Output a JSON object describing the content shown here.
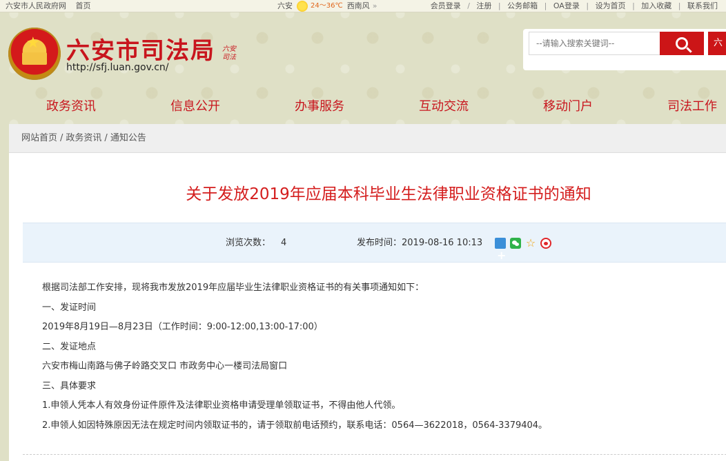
{
  "topbar": {
    "gov_link": "六安市人民政府网",
    "home_link": "首页",
    "city": "六安",
    "temperature": "24～36℃",
    "wind": "西南风",
    "more_arrow": "»",
    "links": [
      "会员登录",
      "注册",
      "公务邮箱",
      "OA登录",
      "设为首页",
      "加入收藏",
      "联系我们"
    ],
    "sep_slash": "/",
    "sep_bar": "|"
  },
  "header": {
    "site_title": "六安市司法局",
    "site_url": "http://sfj.luan.gov.cn/",
    "seal_text": "六安司法",
    "emblem_star": "★"
  },
  "search": {
    "placeholder": "--请输入搜索关键词--",
    "lang_button": "六"
  },
  "nav": {
    "items": [
      "政务资讯",
      "信息公开",
      "办事服务",
      "互动交流",
      "移动门户",
      "司法工作"
    ]
  },
  "breadcrumb": {
    "items": [
      "网站首页",
      "政务资讯",
      "通知公告"
    ],
    "separator": "/"
  },
  "article": {
    "title": "关于发放2019年应届本科毕业生法律职业资格证书的通知",
    "views_label": "浏览次数：",
    "views_value": "4",
    "date_label": "发布时间：2019-08-16 10:13",
    "fav_symbol": "☆",
    "paragraphs": [
      "根据司法部工作安排，现将我市发放2019年应届毕业生法律职业资格证书的有关事项通知如下：",
      "一、发证时间",
      "2019年8月19日—8月23日（工作时间：9:00-12:00,13:00-17:00）",
      "二、发证地点",
      "六安市梅山南路与佛子岭路交叉口 市政务中心一楼司法局窗口",
      "三、具体要求",
      "1.申领人凭本人有效身份证件原件及法律职业资格申请受理单领取证书，不得由他人代领。",
      "2.申领人如因特殊原因无法在规定时间内领取证书的，请于领取前电话预约，联系电话：0564—3622018，0564-3379404。"
    ]
  },
  "colors": {
    "brand_red": "#c8151d",
    "title_red": "#d41d1d",
    "meta_bg": "#eaf3fb"
  }
}
